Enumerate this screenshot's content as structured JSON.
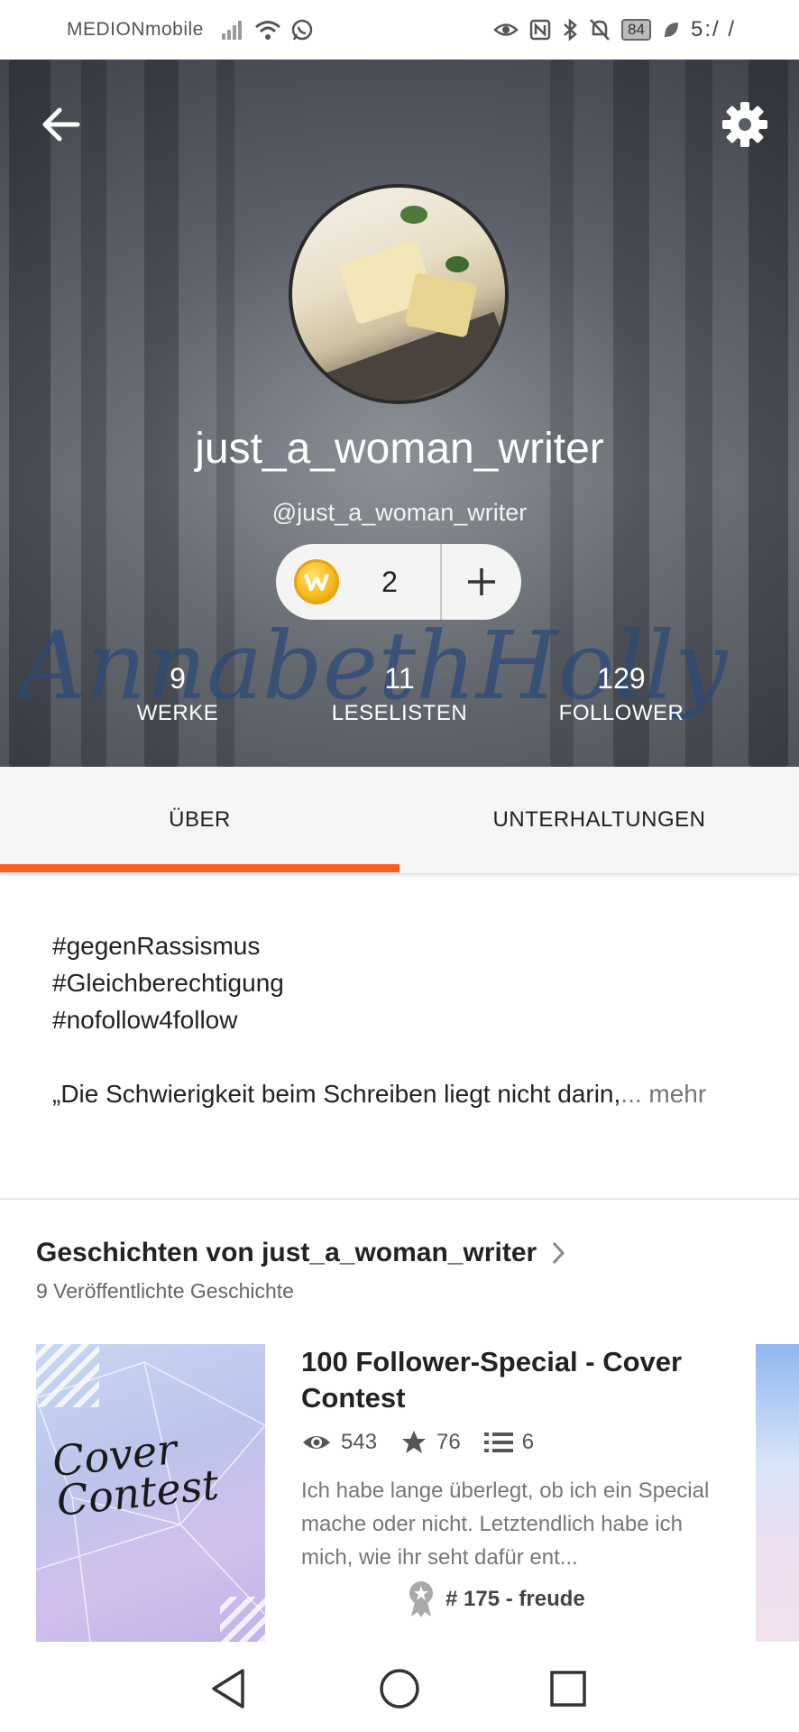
{
  "status_bar": {
    "carrier": "MEDIONmobile",
    "battery": "84",
    "time": "5:/ /"
  },
  "profile": {
    "display_name": "just_a_woman_writer",
    "username": "@just_a_woman_writer",
    "coins": "2",
    "signature_text": "AnnabethHolly",
    "stats": [
      {
        "value": "9",
        "label": "WERKE"
      },
      {
        "value": "11",
        "label": "LESELISTEN"
      },
      {
        "value": "129",
        "label": "FOLLOWER"
      }
    ]
  },
  "tabs": [
    {
      "label": "ÜBER",
      "active": true
    },
    {
      "label": "UNTERHALTUNGEN",
      "active": false
    }
  ],
  "about": {
    "lines": [
      "#gegenRassismus",
      "#Gleichberechtigung",
      "#nofollow4follow"
    ],
    "quote": "„Die Schwierigkeit beim Schreiben liegt nicht darin,",
    "more": "... mehr"
  },
  "stories": {
    "title": "Geschichten von just_a_woman_writer",
    "subtitle": "9 Veröffentlichte Geschichte",
    "items": [
      {
        "cover_text": "Cover Contest",
        "title": "100 Follower-Special - Cover Contest",
        "views": "543",
        "votes": "76",
        "parts": "6",
        "description": "Ich habe lange überlegt, ob ich ein Special mache oder nicht. Letztendlich habe ich mich, wie ihr seht dafür ent...",
        "rank": "# 175 - freude"
      }
    ]
  },
  "colors": {
    "accent": "#ff5b1f",
    "coin": "#f6b81a"
  }
}
